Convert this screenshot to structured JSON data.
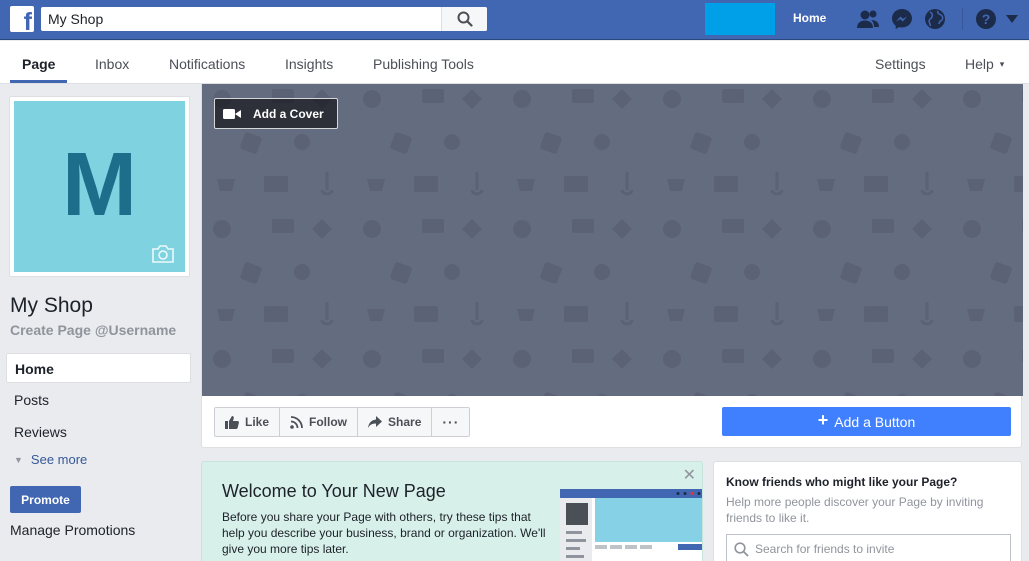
{
  "topbar": {
    "logo_glyph": "f",
    "search_value": "My Shop",
    "home_label": "Home",
    "icons": [
      "friends-icon",
      "messenger-icon",
      "globe-icon",
      "help-icon",
      "caret-down-icon"
    ],
    "brand_color": "#4267b2"
  },
  "tabs": {
    "items": [
      {
        "label": "Page"
      },
      {
        "label": "Inbox"
      },
      {
        "label": "Notifications"
      },
      {
        "label": "Insights"
      },
      {
        "label": "Publishing Tools"
      }
    ],
    "settings_label": "Settings",
    "help_label": "Help",
    "help_caret": "▾"
  },
  "profile": {
    "letter": "M",
    "name": "My Shop",
    "username_prompt": "Create Page @Username"
  },
  "leftnav": {
    "home": "Home",
    "posts": "Posts",
    "reviews": "Reviews",
    "see_more": "See more",
    "caret": "▼",
    "promote": "Promote",
    "manage_promotions": "Manage Promotions"
  },
  "cover": {
    "add_cover_label": "Add a Cover"
  },
  "actions": {
    "like": "Like",
    "follow": "Follow",
    "share": "Share",
    "more": "···",
    "add_button": "Add a Button",
    "plus": "+",
    "accent": "#4080ff"
  },
  "welcome": {
    "title": "Welcome to Your New Page",
    "body": "Before you share your Page with others, try these tips that help you describe your business, brand or organization. We'll give you more tips later.",
    "close": "✕"
  },
  "friends": {
    "title": "Know friends who might like your Page?",
    "subtitle": "Help more people discover your Page by inviting friends to like it.",
    "search_placeholder": "Search for friends to invite"
  }
}
